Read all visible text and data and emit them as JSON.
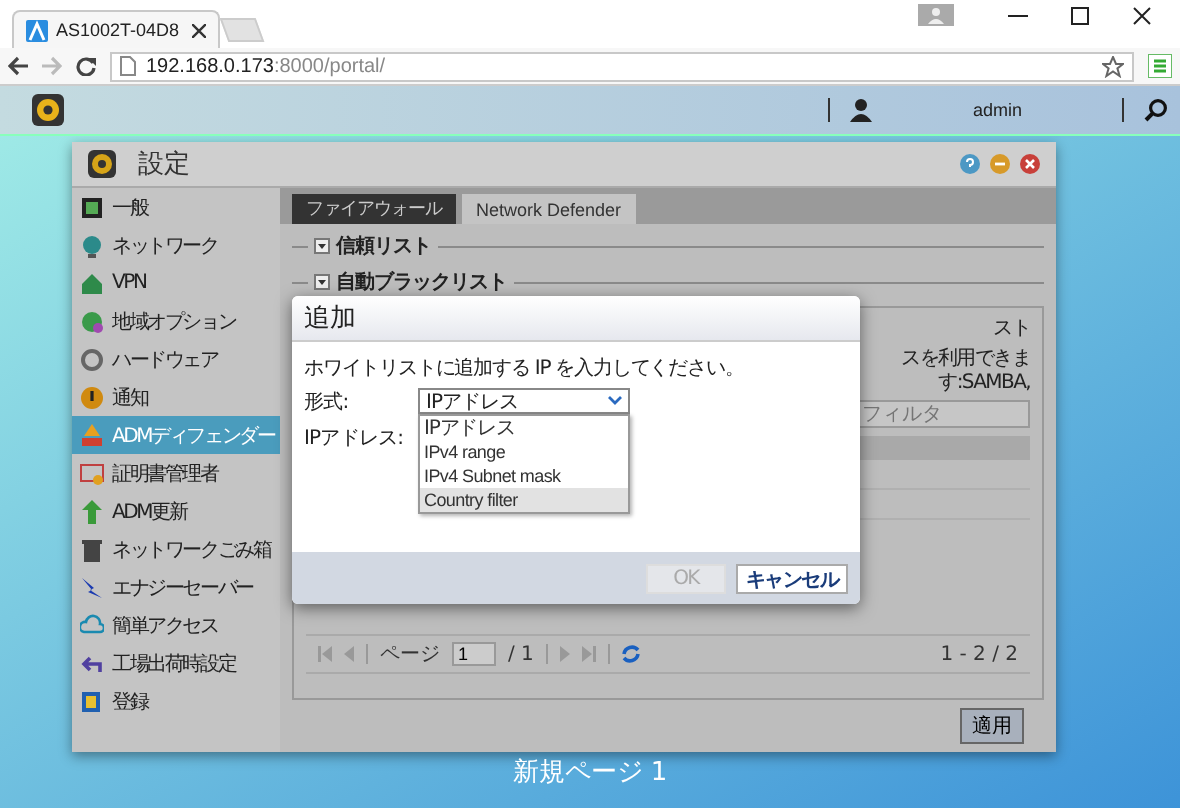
{
  "browser": {
    "tab_title": "AS1002T-04D8",
    "address_host": "192.168.0.173",
    "address_path": ":8000/portal/"
  },
  "app_bar": {
    "user": "admin"
  },
  "window": {
    "title": "設定"
  },
  "sidebar": {
    "items": [
      {
        "label": "一般",
        "selected": false
      },
      {
        "label": "ネットワーク",
        "selected": false
      },
      {
        "label": "VPN",
        "selected": false
      },
      {
        "label": "地域オプション",
        "selected": false
      },
      {
        "label": "ハードウェア",
        "selected": false
      },
      {
        "label": "通知",
        "selected": false
      },
      {
        "label": "ADMディフェンダー",
        "selected": true
      },
      {
        "label": "証明書管理者",
        "selected": false
      },
      {
        "label": "ADM更新",
        "selected": false
      },
      {
        "label": "ネットワークごみ箱",
        "selected": false
      },
      {
        "label": "エナジーセーバー",
        "selected": false
      },
      {
        "label": "簡単アクセス",
        "selected": false
      },
      {
        "label": "工場出荷時設定",
        "selected": false
      },
      {
        "label": "登録",
        "selected": false
      }
    ]
  },
  "tabs": [
    {
      "label": "ファイアウォール",
      "selected": false
    },
    {
      "label": "Network Defender",
      "selected": true
    }
  ],
  "sections": [
    {
      "label": "信頼リスト"
    },
    {
      "label": "自動ブラックリスト"
    }
  ],
  "panel": {
    "heading_fragment": "スト",
    "note_fragment": "スを利用できます:SAMBA,",
    "filter_placeholder": "フィルタ"
  },
  "pager": {
    "page_label": "ページ",
    "page": "1",
    "total": "/ 1",
    "range": "1 - 2 / 2"
  },
  "apply_button": "適用",
  "dialog": {
    "title": "追加",
    "message": "ホワイトリストに追加する IP を入力してください。",
    "format_label": "形式:",
    "format_value": "IPアドレス",
    "ip_label": "IPアドレス:",
    "options": [
      {
        "label": "IPアドレス",
        "selected": false
      },
      {
        "label": "IPv4 range",
        "selected": false
      },
      {
        "label": "IPv4 Subnet mask",
        "selected": false
      },
      {
        "label": "Country filter",
        "selected": true
      }
    ],
    "buttons": [
      {
        "label": "OK",
        "disabled": true
      },
      {
        "label": "キャンセル",
        "disabled": false
      }
    ]
  },
  "caption": "新規ページ 1"
}
